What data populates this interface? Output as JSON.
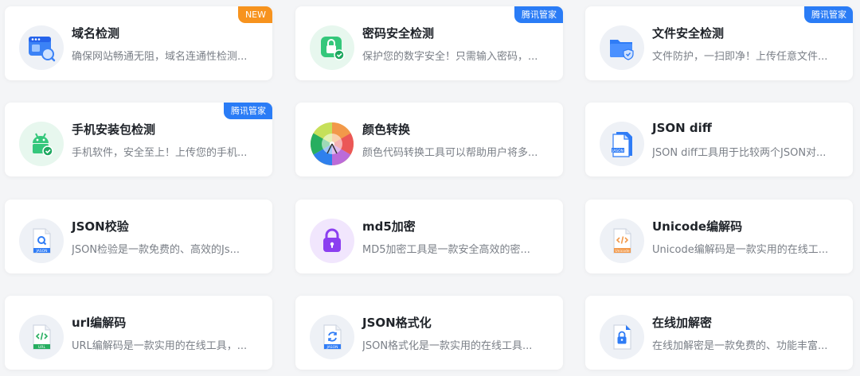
{
  "colors": {
    "new_badge": "#f7931e",
    "tencent_badge": "#2a7cf6",
    "card_bg": "#ffffff",
    "page_bg": "#f4f5f7"
  },
  "cards": [
    {
      "title": "域名检测",
      "desc": "确保网站畅通无阻，域名连通性检测...",
      "badge": "NEW",
      "icon": "domain-check-icon"
    },
    {
      "title": "密码安全检测",
      "desc": "保护您的数字安全！只需输入密码，...",
      "badge": "腾讯管家",
      "icon": "password-lock-icon"
    },
    {
      "title": "文件安全检测",
      "desc": "文件防护，一扫即净！上传任意文件...",
      "badge": "腾讯管家",
      "icon": "folder-shield-icon"
    },
    {
      "title": "手机安装包检测",
      "desc": "手机软件，安全至上！上传您的手机...",
      "badge": "腾讯管家",
      "icon": "android-shield-icon"
    },
    {
      "title": "颜色转换",
      "desc": "颜色代码转换工具可以帮助用户将多...",
      "badge": "",
      "icon": "color-wheel-icon"
    },
    {
      "title": "JSON diff",
      "desc": "JSON diff工具用于比较两个JSON对...",
      "badge": "",
      "icon": "json-diff-icon"
    },
    {
      "title": "JSON校验",
      "desc": "JSON检验是一款免费的、高效的Js...",
      "badge": "",
      "icon": "json-search-icon"
    },
    {
      "title": "md5加密",
      "desc": "MD5加密工具是一款安全高效的密...",
      "badge": "",
      "icon": "purple-lock-icon"
    },
    {
      "title": "Unicode编解码",
      "desc": "Unicode编解码是一款实用的在线工...",
      "badge": "",
      "icon": "unicode-file-icon"
    },
    {
      "title": "url编解码",
      "desc": "URL编解码是一款实用的在线工具，...",
      "badge": "",
      "icon": "url-file-icon"
    },
    {
      "title": "JSON格式化",
      "desc": "JSON格式化是一款实用的在线工具...",
      "badge": "",
      "icon": "json-format-icon"
    },
    {
      "title": "在线加解密",
      "desc": "在线加解密是一款免费的、功能丰富...",
      "badge": "",
      "icon": "file-lock-icon"
    }
  ],
  "file_icon_labels": {
    "json": "JASON",
    "unicode": "Unicode",
    "url": "URL"
  }
}
